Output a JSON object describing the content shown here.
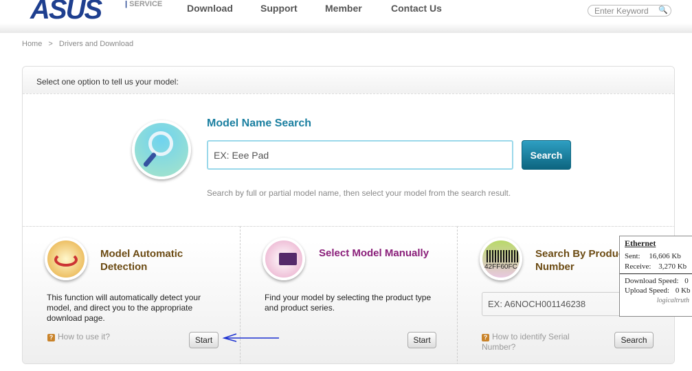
{
  "header": {
    "logo": "ASUS",
    "service": "SERVICE",
    "nav": [
      "Download",
      "Support",
      "Member",
      "Contact Us"
    ],
    "search_placeholder": "Enter Keyword"
  },
  "breadcrumb": {
    "home": "Home",
    "sep": ">",
    "current": "Drivers and Download"
  },
  "panel": {
    "prompt": "Select one option to tell us your model:"
  },
  "model_search": {
    "title": "Model Name Search",
    "placeholder": "EX: Eee Pad",
    "button": "Search",
    "hint": "Search by full or partial model name, then select your model from the search result."
  },
  "auto": {
    "title": "Model Automatic Detection",
    "desc": "This function will automatically detect your model, and direct you to the appropriate download page.",
    "help": "How to use it?",
    "button": "Start"
  },
  "manual": {
    "title": "Select Model Manually",
    "desc": "Find your model by selecting the product type and product series.",
    "button": "Start"
  },
  "serial": {
    "title": "Search By Product Number",
    "placeholder": "EX: A6NOCH001146238",
    "help": "How to identify Serial Number?",
    "button": "Search",
    "barcode_text": "42FF60FC"
  },
  "ethernet": {
    "title": "Ethernet",
    "sent_label": "Sent:",
    "sent": "16,606 Kb",
    "recv_label": "Receive:",
    "recv": "3,270 Kb",
    "dl_label": "Download Speed:",
    "dl": "0",
    "ul_label": "Upload Speed:",
    "ul": "0 Kb",
    "brand": "logicaltruth"
  },
  "colors": {
    "brand": "#1e3f8f",
    "accent": "#1a7fa0",
    "auto_title": "#6b4a12",
    "manual_title": "#8a1f7a"
  }
}
